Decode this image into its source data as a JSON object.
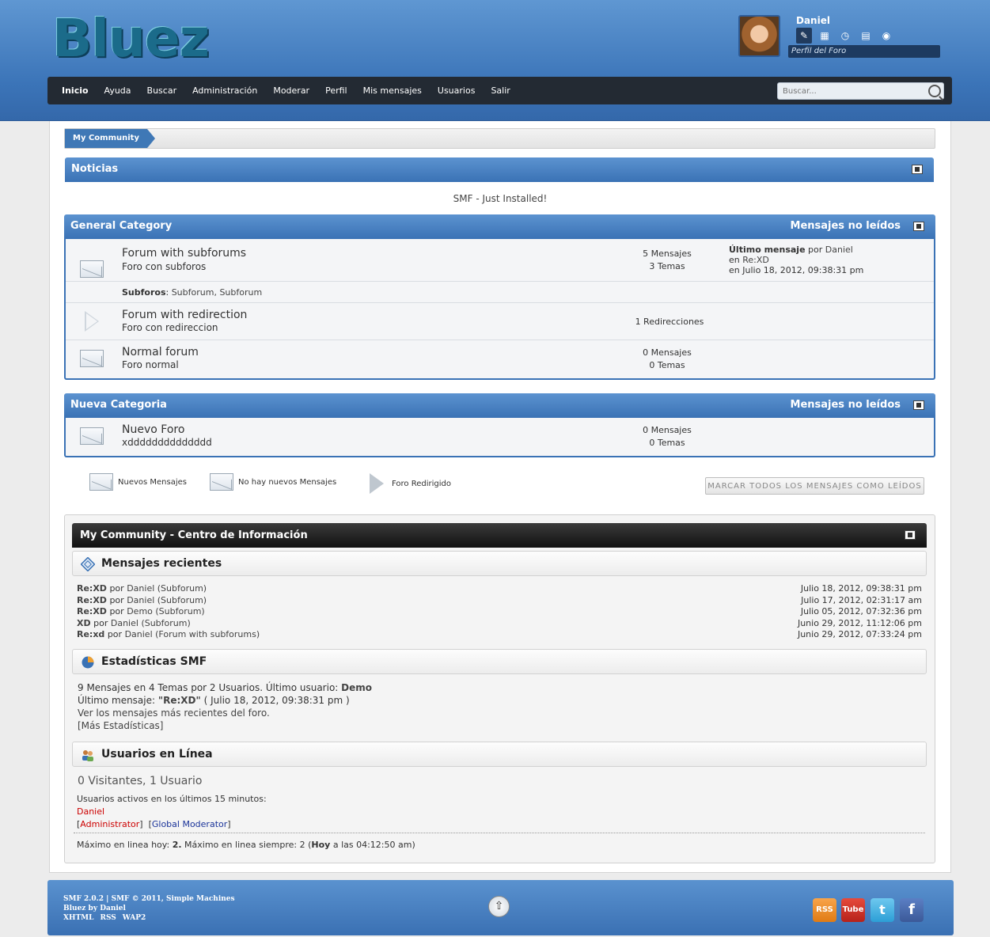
{
  "header": {
    "logo": "Bluez",
    "username": "Daniel",
    "profile_label": "Perfil del Foro",
    "user_icons": [
      "profile-icon",
      "edit-icon",
      "clock-icon",
      "document-icon",
      "chat-icon"
    ]
  },
  "nav": {
    "items": [
      "Inicio",
      "Ayuda",
      "Buscar",
      "Administración",
      "Moderar",
      "Perfil",
      "Mis mensajes",
      "Usuarios",
      "Salir"
    ],
    "search_placeholder": "Buscar..."
  },
  "breadcrumb": {
    "item": "My Community"
  },
  "news": {
    "title": "Noticias",
    "text": "SMF - Just Installed!"
  },
  "categories": [
    {
      "name": "General Category",
      "unread": "Mensajes no leídos",
      "boards": [
        {
          "name": "Forum with subforums",
          "desc": "Foro con subforos",
          "stat1": "5 Mensajes",
          "stat2": "3 Temas",
          "last_label": "Último mensaje",
          "last_by": "por",
          "last_user": "Daniel",
          "last_in": "en",
          "last_topic": "Re:XD",
          "last_date": "en Julio 18, 2012, 09:38:31 pm",
          "sub_label": "Subforos",
          "subforums": "Subforum, Subforum"
        },
        {
          "name": "Forum with redirection",
          "desc": "Foro con redireccion",
          "stat1": "1 Redirecciones"
        },
        {
          "name": "Normal forum",
          "desc": "Foro normal",
          "stat1": "0 Mensajes",
          "stat2": "0 Temas"
        }
      ]
    },
    {
      "name": "Nueva Categoria",
      "unread": "Mensajes no leídos",
      "boards": [
        {
          "name": "Nuevo Foro",
          "desc": "xdddddddddddddd",
          "stat1": "0 Mensajes",
          "stat2": "0 Temas"
        }
      ]
    }
  ],
  "legend": {
    "new": "Nuevos Mensajes",
    "nonew": "No hay nuevos Mensajes",
    "redirect": "Foro Redirigido",
    "mark_all": "MARCAR TODOS LOS MENSAJES COMO LEÍDOS"
  },
  "info": {
    "title": "My Community - Centro de Información",
    "recent_title": "Mensajes recientes",
    "recent": [
      {
        "subject": "Re:XD",
        "by": "por",
        "user": "Daniel",
        "board": "(Subforum)",
        "date": "Julio 18, 2012, 09:38:31 pm"
      },
      {
        "subject": "Re:XD",
        "by": "por",
        "user": "Daniel",
        "board": "(Subforum)",
        "date": "Julio 17, 2012, 02:31:17 am"
      },
      {
        "subject": "Re:XD",
        "by": "por",
        "user": "Demo",
        "board": "(Subforum)",
        "date": "Julio 05, 2012, 07:32:36 pm"
      },
      {
        "subject": "XD",
        "by": "por",
        "user": "Daniel",
        "board": "(Subforum)",
        "date": "Junio 29, 2012, 11:12:06 pm"
      },
      {
        "subject": "Re:xd",
        "by": "por",
        "user": "Daniel",
        "board": "(Forum with subforums)",
        "date": "Junio 29, 2012, 07:33:24 pm"
      }
    ],
    "stats_title": "Estadísticas SMF",
    "stats_line1": "9 Mensajes en 4 Temas por 2 Usuarios. Último usuario:",
    "stats_latest_member": "Demo",
    "stats_line2a": "Último mensaje:",
    "stats_line2_topic": "\"Re:XD\"",
    "stats_line2_date": "( Julio 18, 2012, 09:38:31 pm )",
    "stats_line3": "Ver los mensajes más recientes del foro.",
    "stats_line4": "[Más Estadísticas]",
    "online_title": "Usuarios en Línea",
    "online_count": "0 Visitantes, 1 Usuario",
    "online_active": "Usuarios activos en los últimos 15 minutos:",
    "online_user": "Daniel",
    "group_admin": "Administrator",
    "group_mod": "Global Moderator",
    "max_a": "Máximo en linea hoy:",
    "max_today": "2.",
    "max_b": "Máximo en linea siempre: 2 (",
    "max_hoy": "Hoy",
    "max_c": "a las 04:12:50 am)"
  },
  "footer": {
    "line1": "SMF 2.0.2 | SMF © 2011, Simple Machines",
    "line2": "Bluez by Daniel",
    "links": [
      "XHTML",
      "RSS",
      "WAP2"
    ],
    "social_rss": "RSS",
    "social_tube": "Tube",
    "social_twitter": "t",
    "social_fb": "f"
  },
  "colors": {
    "accent": "#3a72b5",
    "nav_bg": "#232a33",
    "admin_red": "#cc0000",
    "mod_blue": "#1a3399"
  }
}
